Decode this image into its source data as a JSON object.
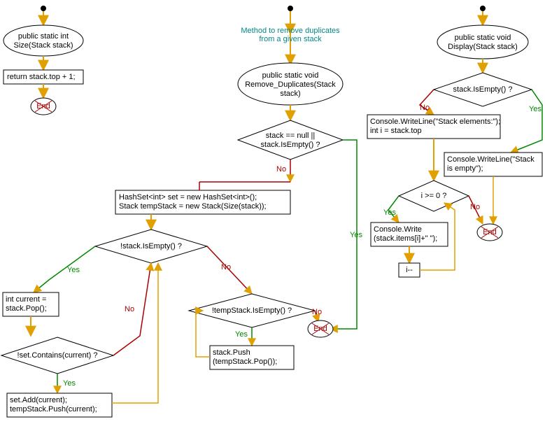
{
  "flowcharts": {
    "size": {
      "start": {
        "label": "public static int\nSize(Stack stack)"
      },
      "return": {
        "label": "return stack.top + 1;"
      },
      "end": {
        "label": "End"
      }
    },
    "remove_duplicates": {
      "annotation": "Method to remove duplicates\nfrom a given stack",
      "start": {
        "label": "public static void\nRemove_Duplicates(Stack\nstack)"
      },
      "cond_null": {
        "label": "stack == null ||\nstack.IsEmpty() ?"
      },
      "init": {
        "label": "HashSet<int> set = new HashSet<int>();\nStack tempStack = new Stack(Size(stack));"
      },
      "cond_empty": {
        "label": "!stack.IsEmpty() ?"
      },
      "assign_current": {
        "label": "int current =\nstack.Pop();"
      },
      "cond_contains": {
        "label": "!set.Contains(current) ?"
      },
      "add_push": {
        "label": "set.Add(current);\ntempStack.Push(current);"
      },
      "cond_temp_empty": {
        "label": "!tempStack.IsEmpty() ?"
      },
      "push_back": {
        "label": "stack.Push\n(tempStack.Pop());"
      },
      "end": {
        "label": "End"
      }
    },
    "display": {
      "start": {
        "label": "public static void\nDisplay(Stack stack)"
      },
      "cond_empty": {
        "label": "stack.IsEmpty() ?"
      },
      "print_header": {
        "label": "Console.WriteLine(\"Stack elements:\");\nint i = stack.top"
      },
      "print_empty": {
        "label": "Console.WriteLine(\"Stack\nis empty\");"
      },
      "cond_i": {
        "label": "i >= 0 ?"
      },
      "write_item": {
        "label": "Console.Write\n(stack.items[i]+\" \");"
      },
      "decrement": {
        "label": "i--"
      },
      "end": {
        "label": "End"
      }
    }
  },
  "labels": {
    "yes": "Yes",
    "no": "No"
  },
  "chart_data": {
    "type": "flowchart",
    "flows": [
      {
        "name": "Size",
        "nodes": [
          {
            "id": "size_entry",
            "kind": "entry",
            "text": ""
          },
          {
            "id": "size_start",
            "kind": "terminator",
            "text": "public static int Size(Stack stack)"
          },
          {
            "id": "size_return",
            "kind": "process",
            "text": "return stack.top + 1;"
          },
          {
            "id": "size_end",
            "kind": "end",
            "text": "End"
          }
        ],
        "edges": [
          {
            "from": "size_entry",
            "to": "size_start"
          },
          {
            "from": "size_start",
            "to": "size_return"
          },
          {
            "from": "size_return",
            "to": "size_end"
          }
        ]
      },
      {
        "name": "Remove_Duplicates",
        "annotation": "Method to remove duplicates from a given stack",
        "nodes": [
          {
            "id": "rd_entry",
            "kind": "entry",
            "text": ""
          },
          {
            "id": "rd_start",
            "kind": "terminator",
            "text": "public static void Remove_Duplicates(Stack stack)"
          },
          {
            "id": "rd_cond_null",
            "kind": "decision",
            "text": "stack == null || stack.IsEmpty() ?"
          },
          {
            "id": "rd_init",
            "kind": "process",
            "text": "HashSet<int> set = new HashSet<int>(); Stack tempStack = new Stack(Size(stack));"
          },
          {
            "id": "rd_cond_empty",
            "kind": "decision",
            "text": "!stack.IsEmpty() ?"
          },
          {
            "id": "rd_assign",
            "kind": "process",
            "text": "int current = stack.Pop();"
          },
          {
            "id": "rd_cond_cont",
            "kind": "decision",
            "text": "!set.Contains(current) ?"
          },
          {
            "id": "rd_add_push",
            "kind": "process",
            "text": "set.Add(current); tempStack.Push(current);"
          },
          {
            "id": "rd_cond_temp",
            "kind": "decision",
            "text": "!tempStack.IsEmpty() ?"
          },
          {
            "id": "rd_push_back",
            "kind": "process",
            "text": "stack.Push(tempStack.Pop());"
          },
          {
            "id": "rd_end",
            "kind": "end",
            "text": "End"
          }
        ],
        "edges": [
          {
            "from": "rd_entry",
            "to": "rd_start"
          },
          {
            "from": "rd_start",
            "to": "rd_cond_null"
          },
          {
            "from": "rd_cond_null",
            "to": "rd_end",
            "label": "Yes"
          },
          {
            "from": "rd_cond_null",
            "to": "rd_init",
            "label": "No"
          },
          {
            "from": "rd_init",
            "to": "rd_cond_empty"
          },
          {
            "from": "rd_cond_empty",
            "to": "rd_assign",
            "label": "Yes"
          },
          {
            "from": "rd_cond_empty",
            "to": "rd_cond_temp",
            "label": "No"
          },
          {
            "from": "rd_assign",
            "to": "rd_cond_cont"
          },
          {
            "from": "rd_cond_cont",
            "to": "rd_add_push",
            "label": "Yes"
          },
          {
            "from": "rd_cond_cont",
            "to": "rd_cond_empty",
            "label": "No"
          },
          {
            "from": "rd_add_push",
            "to": "rd_cond_empty"
          },
          {
            "from": "rd_cond_temp",
            "to": "rd_push_back",
            "label": "Yes"
          },
          {
            "from": "rd_cond_temp",
            "to": "rd_end",
            "label": "No"
          },
          {
            "from": "rd_push_back",
            "to": "rd_cond_temp"
          }
        ]
      },
      {
        "name": "Display",
        "nodes": [
          {
            "id": "d_entry",
            "kind": "entry",
            "text": ""
          },
          {
            "id": "d_start",
            "kind": "terminator",
            "text": "public static void Display(Stack stack)"
          },
          {
            "id": "d_cond_empty",
            "kind": "decision",
            "text": "stack.IsEmpty() ?"
          },
          {
            "id": "d_header",
            "kind": "process",
            "text": "Console.WriteLine(\"Stack elements:\"); int i = stack.top"
          },
          {
            "id": "d_print_empty",
            "kind": "process",
            "text": "Console.WriteLine(\"Stack is empty\");"
          },
          {
            "id": "d_cond_i",
            "kind": "decision",
            "text": "i >= 0 ?"
          },
          {
            "id": "d_write",
            "kind": "process",
            "text": "Console.Write(stack.items[i]+\" \");"
          },
          {
            "id": "d_dec",
            "kind": "process",
            "text": "i--"
          },
          {
            "id": "d_end",
            "kind": "end",
            "text": "End"
          }
        ],
        "edges": [
          {
            "from": "d_entry",
            "to": "d_start"
          },
          {
            "from": "d_start",
            "to": "d_cond_empty"
          },
          {
            "from": "d_cond_empty",
            "to": "d_print_empty",
            "label": "Yes"
          },
          {
            "from": "d_cond_empty",
            "to": "d_header",
            "label": "No"
          },
          {
            "from": "d_header",
            "to": "d_cond_i"
          },
          {
            "from": "d_print_empty",
            "to": "d_end"
          },
          {
            "from": "d_cond_i",
            "to": "d_write",
            "label": "Yes"
          },
          {
            "from": "d_cond_i",
            "to": "d_end",
            "label": "No"
          },
          {
            "from": "d_write",
            "to": "d_dec"
          },
          {
            "from": "d_dec",
            "to": "d_cond_i"
          }
        ]
      }
    ]
  }
}
